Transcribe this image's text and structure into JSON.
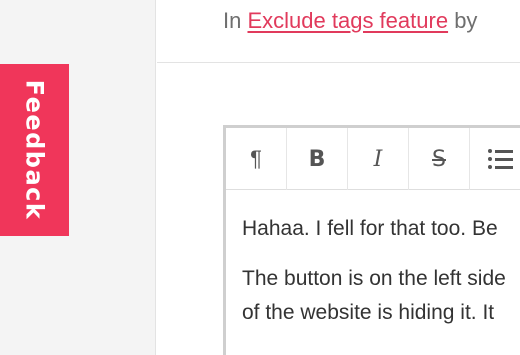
{
  "feedback": {
    "label": "Feedback"
  },
  "topline": {
    "prefix": "In",
    "link": "Exclude tags feature",
    "suffix": "by"
  },
  "toolbar": {
    "paragraph": "¶",
    "bold": "B",
    "italic": "I",
    "strikethrough": "S"
  },
  "content": {
    "para1": "Hahaa. I fell for that too. Be",
    "para2_line1": "The button is on the left side",
    "para2_line2": "of the website is hiding it. It"
  }
}
